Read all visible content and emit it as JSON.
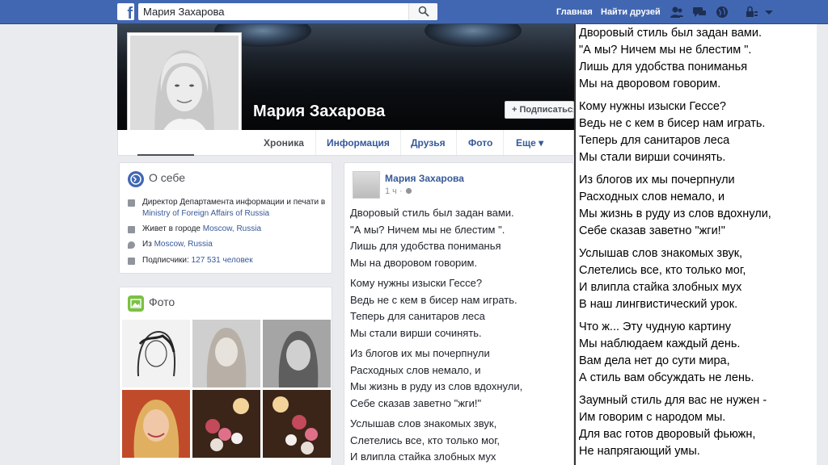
{
  "topbar": {
    "logo": "f",
    "search_value": "Мария Захарова",
    "nav_home": "Главная",
    "nav_find_friends": "Найти друзей",
    "icons": [
      "friend-requests-icon",
      "messages-icon",
      "notifications-icon",
      "privacy-icon",
      "dropdown-icon"
    ]
  },
  "profile": {
    "name": "Мария Захарова",
    "follow_label": "Подписаться"
  },
  "tabs": [
    "Хроника",
    "Информация",
    "Друзья",
    "Фото",
    "Еще ▾"
  ],
  "about": {
    "title": "О себе",
    "job_prefix": "Директор Департамента информации и печати в ",
    "job_org": "Ministry of Foreign Affairs of Russia",
    "lives_prefix": "Живет в городе ",
    "lives_city": "Moscow, Russia",
    "from_prefix": "Из ",
    "from_city": "Moscow, Russia",
    "followers_prefix": "Подписчики: ",
    "followers_count": "127 531 человек"
  },
  "photos": {
    "title": "Фото"
  },
  "post": {
    "author": "Мария Захарова",
    "time": "1 ч",
    "stanzas": [
      "Дворовый стиль был задан вами.\n\"А мы? Ничем мы не блестим \".\nЛишь для удобства пониманья\nМы на дворовом говорим.",
      "Кому нужны изыски Гессе?\nВедь не с кем в бисер нам играть.\nТеперь для санитаров леса\nМы стали вирши сочинять.",
      "Из блогов их мы почерпнули\nРасходных слов немало, и\nМы жизнь в руду из слов вдохнули,\nСебе сказав заветно \"жги!\"",
      "Услышав слов знакомых звук,\nСлетелись все, кто только мог,\nИ влипла стайка злобных мух\nВ наш лингвистический урок."
    ]
  },
  "overlay": {
    "stanzas": [
      "Дворовый стиль был задан вами.\n\"А мы? Ничем мы не блестим \".\nЛишь для удобства пониманья\nМы на дворовом говорим.",
      "Кому нужны изыски Гессе?\nВедь не с кем в бисер нам играть.\nТеперь для санитаров леса\nМы стали вирши сочинять.",
      "Из блогов их мы почерпнули\nРасходных слов немало, и\nМы жизнь в руду из слов вдохнули,\nСебе сказав заветно \"жги!\"",
      "Услышав слов знакомых звук,\nСлетелись все, кто только мог,\nИ влипла стайка злобных мух\nВ наш лингвистический урок.",
      "Что ж... Эту чудную картину\nМы наблюдаем каждый день.\nВам дела нет до сути мира,\nА стиль вам обсуждать не лень.",
      "Заумный стиль для вас не нужен -\nИм говорим с народом мы.\nДля вас готов дворовый фьюжн,\nНе напрягающий умы."
    ]
  },
  "colors": {
    "brand": "#4267b2",
    "link": "#365899",
    "background": "#e9ebee"
  }
}
